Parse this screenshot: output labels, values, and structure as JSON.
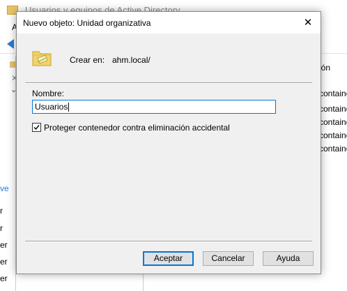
{
  "background_window": {
    "title": "Usuarios y equipos de Active Directory",
    "menu_first": "A",
    "right_header_fragment": "ión",
    "right_rows": [
      "containe",
      "containe",
      "containe",
      "containe",
      "containe"
    ],
    "left_fragments": [
      "ve",
      "r",
      "r",
      "er",
      "er",
      "er"
    ]
  },
  "dialog": {
    "title": "Nuevo objeto: Unidad organizativa",
    "close_glyph": "✕",
    "create_in_label": "Crear en:",
    "create_in_value": "ahm.local/",
    "name_label": "Nombre:",
    "name_value": "Usuarios",
    "protect_checkbox": {
      "label": "Proteger contenedor contra eliminación accidental",
      "checked": true
    },
    "buttons": {
      "ok": "Aceptar",
      "cancel": "Cancelar",
      "help": "Ayuda"
    }
  },
  "icons": {
    "ou": "organizational-unit-icon",
    "close": "close-icon",
    "back": "back-arrow-icon"
  },
  "colors": {
    "accent": "#0078d7",
    "folder": "#e9c46a",
    "dialog_bg": "#f0f0f0"
  }
}
